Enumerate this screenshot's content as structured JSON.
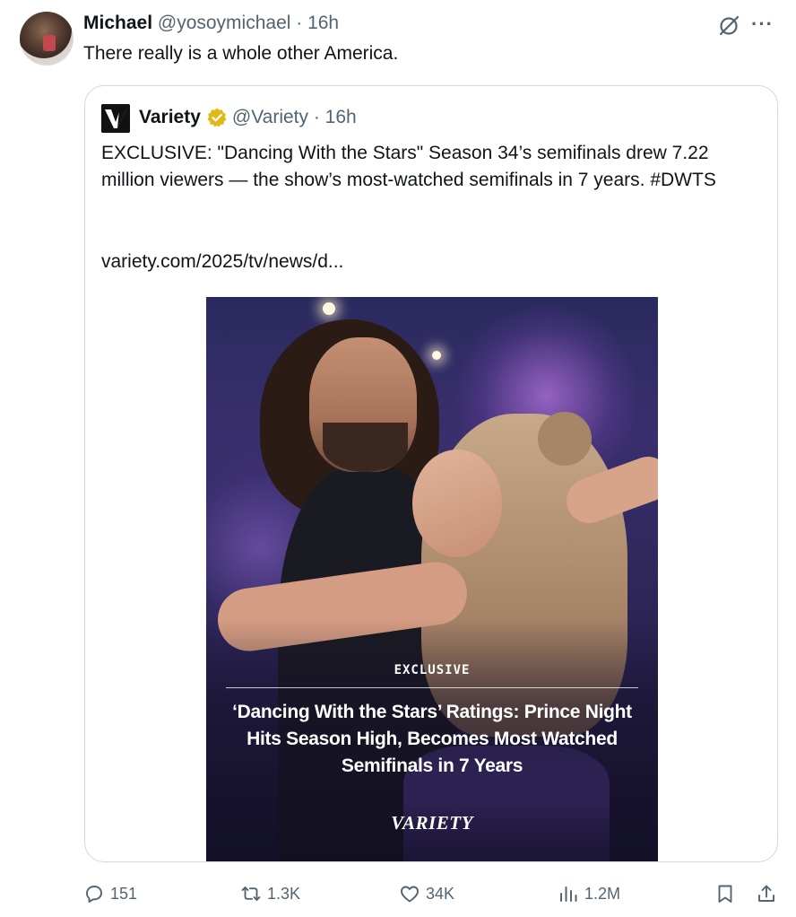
{
  "tweet": {
    "author_name": "Michael",
    "author_meta": "@yosoymichael · 16h",
    "text": "There really is a whole other America."
  },
  "quote": {
    "author_name": "Variety",
    "author_meta": "@Variety · 16h",
    "text": "EXCLUSIVE: \"Dancing With the Stars\" Season 34’s semifinals drew 7.22 million viewers — the show’s most-watched semifinals in 7 years. #DWTS",
    "link": "variety.com/2025/tv/news/d...",
    "media": {
      "tag": "EXCLUSIVE",
      "headline": "‘Dancing With the Stars’ Ratings: Prince Night Hits Season High, Becomes Most Watched Semifinals in 7 Years",
      "brand": "VARIETY"
    }
  },
  "actions": {
    "replies": "151",
    "reposts": "1.3K",
    "likes": "34K",
    "views": "1.2M"
  },
  "colors": {
    "text": "#0f1419",
    "muted": "#536471",
    "border": "#cfd9de",
    "verified_gold": "#e2b719"
  }
}
